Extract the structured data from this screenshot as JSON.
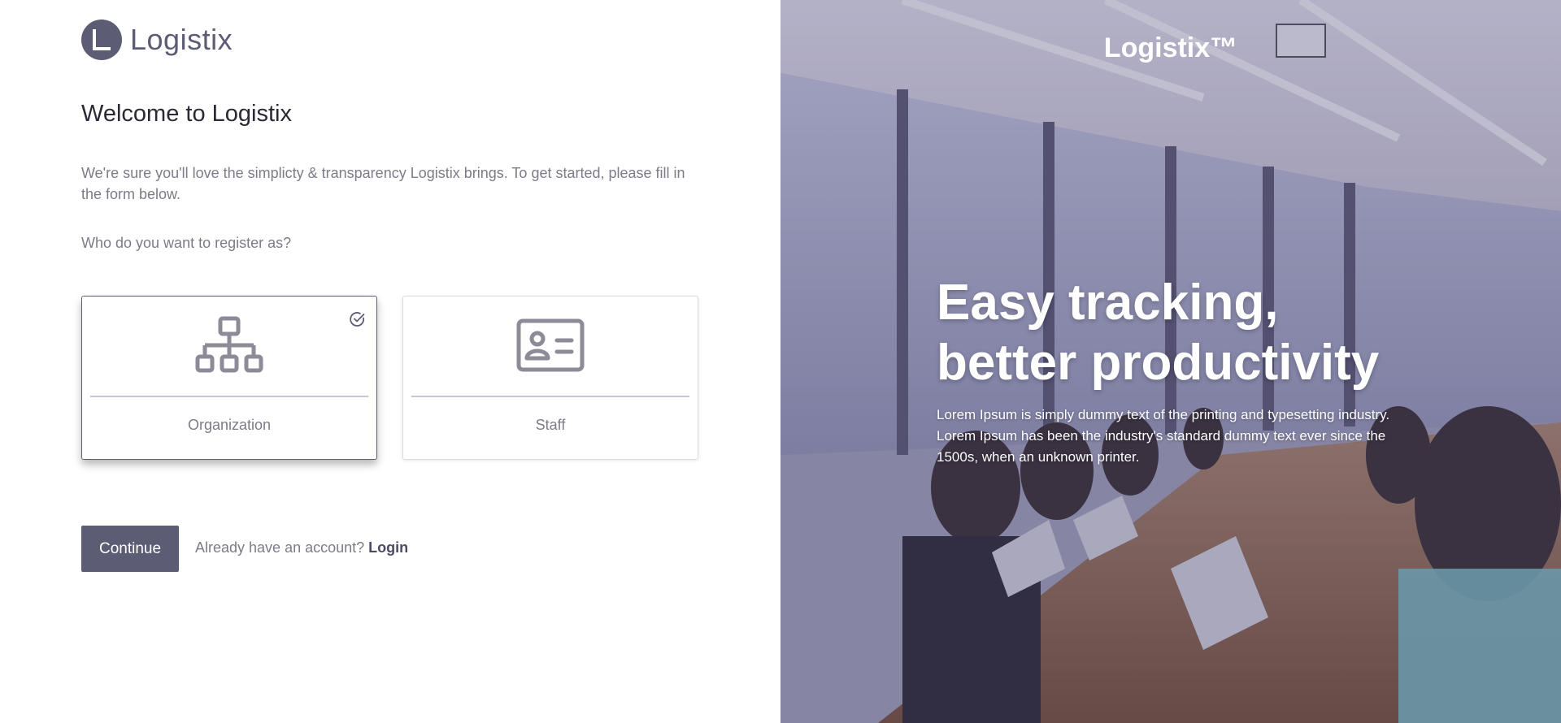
{
  "brand": {
    "logo_text": "Logistix"
  },
  "form": {
    "title": "Welcome to Logistix",
    "intro": "We're sure you'll love the simplicty & transparency Logistix brings. To get started, please fill in the form below.",
    "question": "Who do you want to register as?",
    "options": [
      {
        "label": "Organization",
        "icon": "org-chart-icon",
        "selected": true
      },
      {
        "label": "Staff",
        "icon": "id-card-icon",
        "selected": false
      }
    ],
    "continue_label": "Continue",
    "account_prompt": "Already have an account?",
    "login_label": "Login"
  },
  "hero": {
    "brand": "Logistix™",
    "headline_line1": "Easy tracking,",
    "headline_line2": "better productivity",
    "description": "Lorem Ipsum is simply dummy text of the printing and typesetting industry. Lorem Ipsum has been the industry's standard dummy text ever since the 1500s, when an unknown printer."
  },
  "colors": {
    "accent": "#5d5c75",
    "muted_text": "#7d7b88",
    "heading": "#2a2a35"
  }
}
